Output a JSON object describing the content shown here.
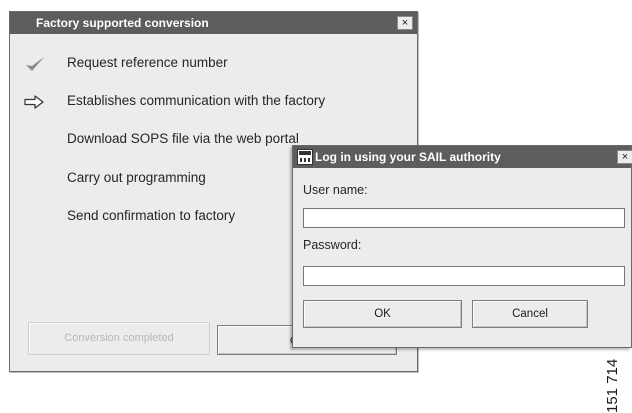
{
  "main_dialog": {
    "title": "Factory supported conversion",
    "close_label": "×",
    "steps": [
      {
        "label": "Request reference number",
        "status": "done",
        "icon": "checkmark-icon"
      },
      {
        "label": "Establishes communication with the factory",
        "status": "current",
        "icon": "arrow-right-icon"
      },
      {
        "label": "Download SOPS file via the web portal",
        "status": "pending",
        "icon": ""
      },
      {
        "label": "Carry out programming",
        "status": "pending",
        "icon": ""
      },
      {
        "label": "Send confirmation to factory",
        "status": "pending",
        "icon": ""
      }
    ],
    "buttons": {
      "conversion_completed": "Conversion completed",
      "cancel": "Cancel"
    }
  },
  "login_dialog": {
    "title": "Log in using your SAIL authority",
    "close_label": "×",
    "username_label": "User name:",
    "username_value": "",
    "password_label": "Password:",
    "password_value": "",
    "ok_label": "OK",
    "cancel_label": "Cancel"
  },
  "figure_number": "151 714",
  "colors": {
    "title_bar": "#5d5d5d",
    "window_bg": "#ececec",
    "check_icon": "#8a8a8a"
  }
}
